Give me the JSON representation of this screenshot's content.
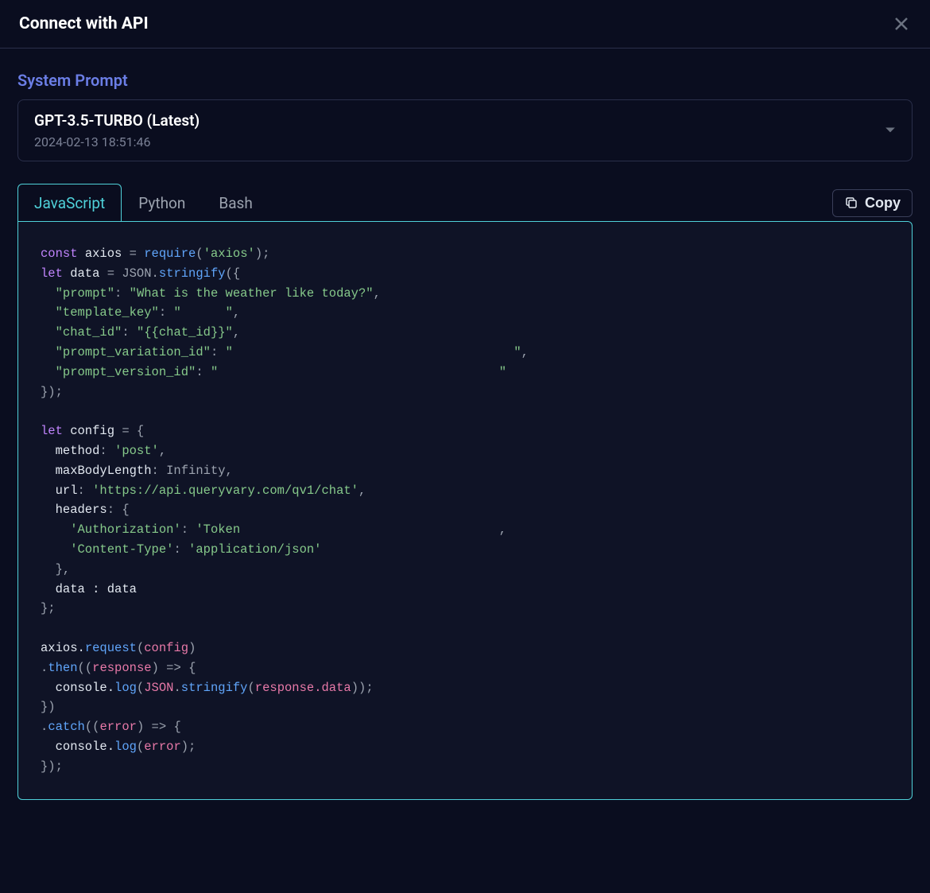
{
  "header": {
    "title": "Connect with API"
  },
  "systemPrompt": {
    "label": "System Prompt",
    "selected": "GPT-3.5-TURBO (Latest)",
    "date": "2024-02-13 18:51:46"
  },
  "tabs": [
    {
      "label": "JavaScript",
      "active": true
    },
    {
      "label": "Python",
      "active": false
    },
    {
      "label": "Bash",
      "active": false
    }
  ],
  "copyButton": {
    "label": "Copy"
  },
  "code": {
    "line1_kw": "const",
    "line1_var": " axios ",
    "line1_eq": "= ",
    "line1_fn": "require",
    "line1_po": "(",
    "line1_str": "'axios'",
    "line1_pc": ");",
    "line2_kw": "let",
    "line2_var": " data ",
    "line2_eq": "= JSON.",
    "line2_fn": "stringify",
    "line2_po": "({",
    "line3_indent": "  ",
    "line3_key": "\"prompt\"",
    "line3_colon": ": ",
    "line3_val": "\"What is the weather like today?\"",
    "line3_comma": ",",
    "line4_key": "\"template_key\"",
    "line4_colon": ": ",
    "line4_val": "\"      \"",
    "line4_comma": ",",
    "line5_key": "\"chat_id\"",
    "line5_colon": ": ",
    "line5_val": "\"{{chat_id}}\"",
    "line5_comma": ",",
    "line6_key": "\"prompt_variation_id\"",
    "line6_colon": ": ",
    "line6_val": "\"                                      \"",
    "line6_comma": ",",
    "line7_key": "\"prompt_version_id\"",
    "line7_colon": ": ",
    "line7_val": "\"                                      \"",
    "line8_close": "});",
    "line10_kw": "let",
    "line10_var": " config ",
    "line10_eq": "= {",
    "line11_key": "  method",
    "line11_colon": ": ",
    "line11_val": "'post'",
    "line11_comma": ",",
    "line12_key": "  maxBodyLength",
    "line12_colon": ": Infinity,",
    "line13_key": "  url",
    "line13_colon": ": ",
    "line13_val": "'https://api.queryvary.com/qv1/chat'",
    "line13_comma": ",",
    "line14_key": "  headers",
    "line14_colon": ": {",
    "line15_key": "    'Authorization'",
    "line15_colon": ": ",
    "line15_val": "'Token                                   ",
    "line15_comma": ",",
    "line16_key": "    'Content-Type'",
    "line16_colon": ": ",
    "line16_val": "'application/json'",
    "line17_close": "  },",
    "line18_data": "  data : data",
    "line19_close": "};",
    "line21_axios": "axios.",
    "line21_fn": "request",
    "line21_po": "(",
    "line21_param": "config",
    "line21_pc": ")",
    "line22_then": ".",
    "line22_fn": "then",
    "line22_po": "((",
    "line22_param": "response",
    "line22_pc": ") => {",
    "line23_console": "  console.",
    "line23_fn": "log",
    "line23_po": "(",
    "line23_json": "JSON",
    "line23_dot": ".",
    "line23_fn2": "stringify",
    "line23_po2": "(",
    "line23_resp": "response.data",
    "line23_pc": "));",
    "line24_close": "})",
    "line25_catch": ".",
    "line25_fn": "catch",
    "line25_po": "((",
    "line25_param": "error",
    "line25_pc": ") => {",
    "line26_console": "  console.",
    "line26_fn": "log",
    "line26_po": "(",
    "line26_param": "error",
    "line26_pc": ");",
    "line27_close": "});"
  }
}
